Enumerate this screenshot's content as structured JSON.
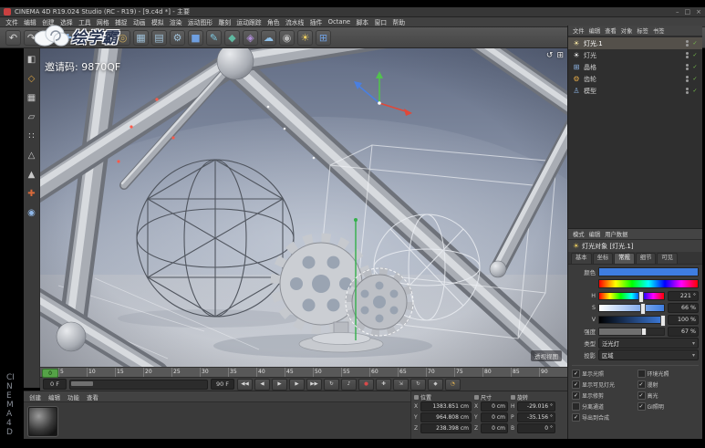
{
  "window": {
    "title": "CINEMA 4D R19.024 Studio (RC - R19) - [9.c4d *] - 主要",
    "controls": {
      "minimize": "–",
      "maximize": "□",
      "close": "×"
    },
    "watermark_text": "绘学霸",
    "invite_code": "邀请码: 9870QF",
    "side_label": "CINEMA 4D"
  },
  "icons": {
    "check": "✓",
    "dropdown": "▾"
  },
  "menu_bar": {
    "items": [
      "文件",
      "编辑",
      "创建",
      "选择",
      "工具",
      "网格",
      "捕捉",
      "动画",
      "模拟",
      "渲染",
      "运动图形",
      "雕刻",
      "运动跟踪",
      "角色",
      "流水线",
      "插件",
      "Octane",
      "脚本",
      "窗口",
      "帮助"
    ]
  },
  "toolbar": {
    "icons": [
      {
        "name": "undo-icon",
        "glyph": "↶",
        "color": "#d5d5d5"
      },
      {
        "name": "redo-icon",
        "glyph": "↷",
        "color": "#d5d5d5"
      },
      {
        "name": "live-selection-icon",
        "glyph": "⊙",
        "color": "#e8d080"
      },
      {
        "name": "move-tool-icon",
        "glyph": "✚",
        "color": "#8fb7e8"
      },
      {
        "name": "scale-tool-icon",
        "glyph": "⇲",
        "color": "#8fb7e8"
      },
      {
        "name": "rotate-tool-icon",
        "glyph": "↻",
        "color": "#8fb7e8"
      },
      {
        "name": "coordinate-system-icon",
        "glyph": "◎",
        "color": "#c9a85a"
      },
      {
        "name": "render-view-icon",
        "glyph": "▦",
        "color": "#9fc0d8"
      },
      {
        "name": "render-picture-viewer-icon",
        "glyph": "▤",
        "color": "#9fc0d8"
      },
      {
        "name": "render-settings-icon",
        "glyph": "⚙",
        "color": "#9fc0d8"
      },
      {
        "name": "add-cube-icon",
        "glyph": "■",
        "color": "#6f9fe0"
      },
      {
        "name": "add-spline-icon",
        "glyph": "✎",
        "color": "#7ec8e0"
      },
      {
        "name": "add-generator-icon",
        "glyph": "◆",
        "color": "#5fb8a0"
      },
      {
        "name": "add-deformer-icon",
        "glyph": "◈",
        "color": "#b08fd8"
      },
      {
        "name": "add-environment-icon",
        "glyph": "☁",
        "color": "#8fc0e8"
      },
      {
        "name": "add-camera-icon",
        "glyph": "◉",
        "color": "#b8b8b8"
      },
      {
        "name": "add-light-icon",
        "glyph": "☀",
        "color": "#f0d060"
      },
      {
        "name": "add-array-icon",
        "glyph": "⊞",
        "color": "#6f9fe0"
      }
    ]
  },
  "left_toolbar": {
    "icons": [
      {
        "name": "make-editable-icon",
        "glyph": "◧",
        "color": "#c9c9c9"
      },
      {
        "name": "model-mode-icon",
        "glyph": "◇",
        "color": "#d9a243"
      },
      {
        "name": "texture-mode-icon",
        "glyph": "▦",
        "color": "#c9c9c9"
      },
      {
        "name": "workplane-mode-icon",
        "glyph": "▱",
        "color": "#c9c9c9"
      },
      {
        "name": "points-mode-icon",
        "glyph": "∷",
        "color": "#c9c9c9"
      },
      {
        "name": "edges-mode-icon",
        "glyph": "△",
        "color": "#c9c9c9"
      },
      {
        "name": "polygons-mode-icon",
        "glyph": "▲",
        "color": "#c9c9c9"
      },
      {
        "name": "axis-mode-icon",
        "glyph": "✚",
        "color": "#d96a3a"
      },
      {
        "name": "snap-icon",
        "glyph": "◉",
        "color": "#8fb7e8"
      }
    ]
  },
  "viewport": {
    "hud_label": "透视视图",
    "corner_icons": [
      "↺",
      "⊞"
    ]
  },
  "timeline": {
    "current": "0",
    "ticks": [
      "5",
      "10",
      "15",
      "20",
      "25",
      "30",
      "35",
      "40",
      "45",
      "50",
      "55",
      "60",
      "65",
      "70",
      "75",
      "80",
      "85",
      "90"
    ],
    "start_frame": "0 F",
    "end_frame": "90 F"
  },
  "transport": {
    "buttons": [
      {
        "name": "goto-start-button",
        "glyph": "◀◀",
        "color": "#d8d8d8"
      },
      {
        "name": "prev-frame-button",
        "glyph": "◀",
        "color": "#d8d8d8"
      },
      {
        "name": "play-button",
        "glyph": "▶",
        "color": "#d8d8d8"
      },
      {
        "name": "next-frame-button",
        "glyph": "▶",
        "color": "#d8d8d8"
      },
      {
        "name": "goto-end-button",
        "glyph": "▶▶",
        "color": "#d8d8d8"
      },
      {
        "name": "loop-button",
        "glyph": "↻",
        "color": "#d8d8d8"
      },
      {
        "name": "sound-toggle-button",
        "glyph": "♪",
        "color": "#d8d8d8"
      },
      {
        "name": "record-keyframe-button",
        "glyph": "●",
        "color": "#d84a4a"
      },
      {
        "name": "record-position-button",
        "glyph": "✚",
        "color": "#c9c9c9"
      },
      {
        "name": "record-scale-button",
        "glyph": "⇲",
        "color": "#c9c9c9"
      },
      {
        "name": "record-rotation-button",
        "glyph": "↻",
        "color": "#c9c9c9"
      },
      {
        "name": "record-parameter-button",
        "glyph": "◆",
        "color": "#c9c9c9"
      },
      {
        "name": "autokey-button",
        "glyph": "◔",
        "color": "#e0b050"
      }
    ]
  },
  "material_manager": {
    "menu": [
      "创建",
      "编辑",
      "功能",
      "查看"
    ]
  },
  "coordinates": {
    "groups": [
      {
        "title": "位置",
        "rows": [
          {
            "axis": "X",
            "value": "1383.851 cm"
          },
          {
            "axis": "Y",
            "value": "964.808 cm"
          },
          {
            "axis": "Z",
            "value": "238.398 cm"
          }
        ]
      },
      {
        "title": "尺寸",
        "rows": [
          {
            "axis": "X",
            "value": "0 cm"
          },
          {
            "axis": "Y",
            "value": "0 cm"
          },
          {
            "axis": "Z",
            "value": "0 cm"
          }
        ]
      },
      {
        "title": "旋转",
        "rows": [
          {
            "axis": "H",
            "value": "-29.016 °"
          },
          {
            "axis": "P",
            "value": "-35.156 °"
          },
          {
            "axis": "B",
            "value": "0 °"
          }
        ]
      }
    ]
  },
  "object_manager": {
    "menu": [
      "文件",
      "编辑",
      "查看",
      "对象",
      "标签",
      "书签"
    ],
    "objects": [
      {
        "name": "灯光.1",
        "glyph": "☀",
        "icon_color": "#f0e0a0",
        "selected": true,
        "check": true
      },
      {
        "name": "灯光",
        "glyph": "☀",
        "icon_color": "#e8e8e8",
        "check": true
      },
      {
        "name": "晶格",
        "glyph": "⊞",
        "icon_color": "#8fb7e8",
        "check": true
      },
      {
        "name": "齿轮",
        "glyph": "⚙",
        "icon_color": "#e0a848",
        "check": true
      },
      {
        "name": "模型",
        "glyph": "♙",
        "icon_color": "#8fb7e8",
        "check": true
      }
    ]
  },
  "attributes": {
    "menu": [
      "模式",
      "编辑",
      "用户数据"
    ],
    "title": "灯光对象 [灯光.1]",
    "tabs": [
      {
        "label": "基本"
      },
      {
        "label": "坐标"
      },
      {
        "label": "常规",
        "active": true
      },
      {
        "label": "细节"
      },
      {
        "label": "可见"
      }
    ],
    "color_label": "颜色",
    "color_value": "#3e7de0",
    "hsv_rows": [
      {
        "label": "H",
        "value": "221 °"
      },
      {
        "label": "S",
        "value": "66 %"
      },
      {
        "label": "V",
        "value": "100 %"
      }
    ],
    "intensity": {
      "label": "强度",
      "value": "67 %"
    },
    "type": {
      "label": "类型",
      "value": "泛光灯"
    },
    "shadow": {
      "label": "投影",
      "value": "区域"
    },
    "checkboxes": [
      {
        "label": "显示光照",
        "checked": true
      },
      {
        "label": "环境光照",
        "checked": false
      },
      {
        "label": "显示可见灯光",
        "checked": true
      },
      {
        "label": "漫射",
        "checked": true
      },
      {
        "label": "显示修剪",
        "checked": true
      },
      {
        "label": "高光",
        "checked": true
      },
      {
        "label": "分离通道",
        "checked": false
      },
      {
        "label": "GI照明",
        "checked": true
      },
      {
        "label": "导出到合成",
        "checked": true
      }
    ]
  }
}
